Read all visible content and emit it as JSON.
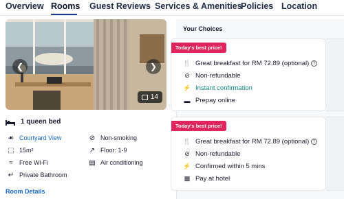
{
  "tabs": [
    "Overview",
    "Rooms",
    "Guest Reviews",
    "Services & Amenities",
    "Policies",
    "Location"
  ],
  "photo": {
    "count": "14"
  },
  "room": {
    "bed": "1 queen bed",
    "features_left": [
      {
        "icon": "courtyard-icon",
        "label": "Courtyard View"
      },
      {
        "icon": "area-icon",
        "label": "15m²"
      },
      {
        "icon": "wifi-icon",
        "label": "Free Wi-Fi"
      },
      {
        "icon": "bathroom-icon",
        "label": "Private Bathroom"
      }
    ],
    "features_right": [
      {
        "icon": "no-smoking-icon",
        "label": "Non-smoking"
      },
      {
        "icon": "floor-icon",
        "label": "Floor: 1-9"
      },
      {
        "icon": "ac-icon",
        "label": "Air conditioning"
      }
    ],
    "details_link": "Room Details"
  },
  "panel": {
    "title": "Your Choices",
    "cards": [
      {
        "badge": "Today's best price!",
        "rows": [
          {
            "icon": "breakfast-icon",
            "label": "Great breakfast for RM 72.89 (optional)"
          },
          {
            "icon": "non-refundable-icon",
            "label": "Non-refundable"
          },
          {
            "icon": "lightning-icon",
            "label": "Instant confirmation"
          },
          {
            "icon": "card-icon",
            "label": "Prepay online"
          }
        ]
      },
      {
        "badge": "Today's best price!",
        "rows": [
          {
            "icon": "breakfast-icon",
            "label": "Great breakfast for RM 72.89 (optional)"
          },
          {
            "icon": "non-refundable-icon",
            "label": "Non-refundable"
          },
          {
            "icon": "lightning-icon",
            "label": "Confirmed within 5 mins"
          },
          {
            "icon": "hotel-pay-icon",
            "label": "Pay at hotel"
          }
        ]
      }
    ]
  },
  "colors": {
    "accent": "#1569c7",
    "badge": "#e0245e",
    "green": "#0e8a7d",
    "active_tab": "#1e3a8a"
  }
}
